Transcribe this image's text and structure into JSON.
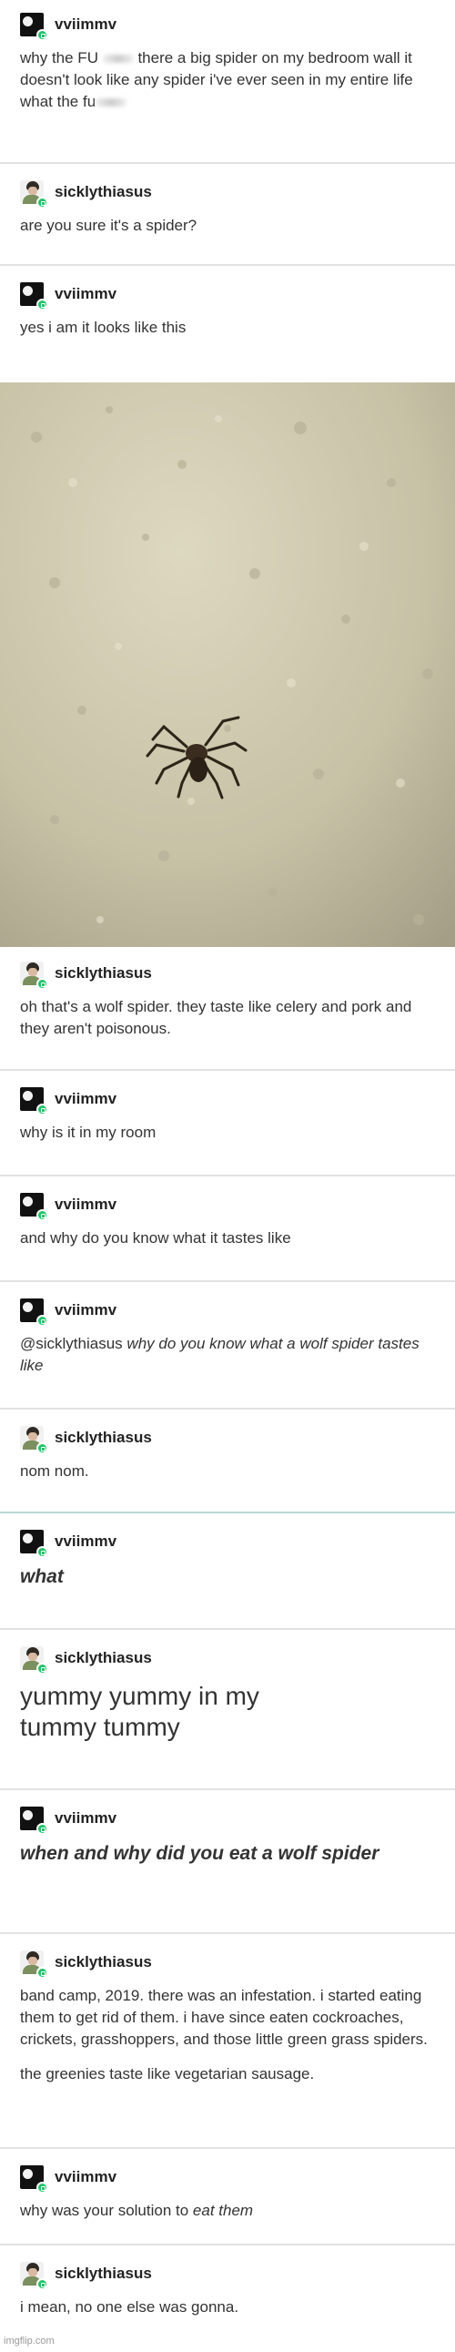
{
  "posts": [
    {
      "user": "vviimmv",
      "text_a": "why the FU",
      "text_b": " there a big spider on my bedroom wall it doesn't look like any spider i've ever seen in my entire life what the fu"
    },
    {
      "user": "sicklythiasus",
      "text": "are you sure it's a spider?"
    },
    {
      "user": "vviimmv",
      "text": "yes i am it looks like this"
    },
    {
      "user": "sicklythiasus",
      "text": "oh that's a wolf spider. they taste like celery and pork and they aren't poisonous."
    },
    {
      "user": "vviimmv",
      "text": "why is it in my room"
    },
    {
      "user": "vviimmv",
      "text": "and why do you know what it tastes like"
    },
    {
      "user": "vviimmv",
      "mention": "@sicklythiasus",
      "text": "why do you know what a wolf spider tastes like"
    },
    {
      "user": "sicklythiasus",
      "text": "nom nom."
    },
    {
      "user": "vviimmv",
      "text": "what"
    },
    {
      "user": "sicklythiasus",
      "text": "yummy yummy in my tummy tummy"
    },
    {
      "user": "vviimmv",
      "text": "when and why did you eat a wolf spider"
    },
    {
      "user": "sicklythiasus",
      "text": "band camp, 2019. there was an infestation. i started eating them to get rid of them. i have since eaten cockroaches, crickets, grasshoppers, and those little green grass spiders.",
      "text2": "the greenies taste like vegetarian sausage."
    },
    {
      "user": "vviimmv",
      "text_a": "why was your solution to ",
      "text_b": "eat them"
    },
    {
      "user": "sicklythiasus",
      "text": "i mean, no one else was gonna."
    }
  ],
  "watermark": "imgflip.com"
}
